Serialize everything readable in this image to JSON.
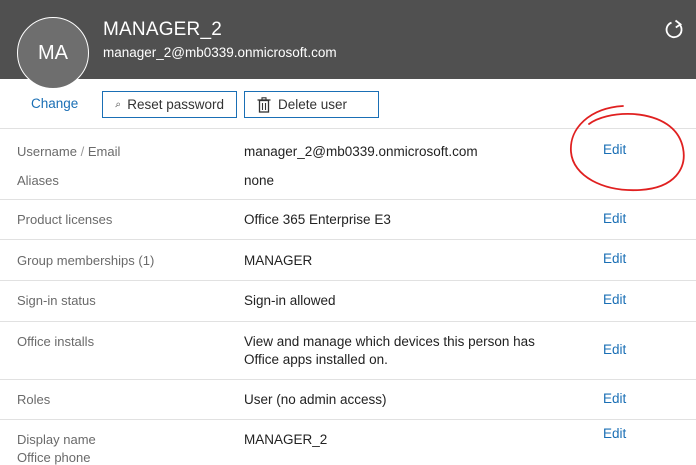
{
  "user": {
    "initials": "MA",
    "name": "MANAGER_2",
    "email": "manager_2@mb0339.onmicrosoft.com"
  },
  "actions": {
    "change_label": "Change",
    "reset_password_label": "Reset password",
    "delete_user_label": "Delete user"
  },
  "rows": [
    {
      "label_a": "Username",
      "label_sep": "/",
      "label_b": "Email",
      "value": "manager_2@mb0339.onmicrosoft.com",
      "edit": "Edit",
      "label2": "Aliases",
      "value2": "none"
    },
    {
      "label": "Product licenses",
      "value": "Office 365 Enterprise E3",
      "edit": "Edit"
    },
    {
      "label": "Group memberships (1)",
      "value": "MANAGER",
      "edit": "Edit"
    },
    {
      "label": "Sign-in status",
      "value": "Sign-in allowed",
      "edit": "Edit"
    },
    {
      "label": "Office installs",
      "value_line1": "View and manage which devices this person has",
      "value_line2": "Office apps installed on.",
      "edit": "Edit"
    },
    {
      "label": "Roles",
      "value": "User (no admin access)",
      "edit": "Edit"
    },
    {
      "label": "Display name",
      "label2": "Office phone",
      "value": "MANAGER_2",
      "edit": "Edit"
    }
  ],
  "colors": {
    "header_bg": "#505050",
    "link": "#1a6fb5",
    "annotation": "#e02020"
  },
  "icons": [
    "refresh-icon",
    "search-key-icon",
    "trash-icon"
  ]
}
